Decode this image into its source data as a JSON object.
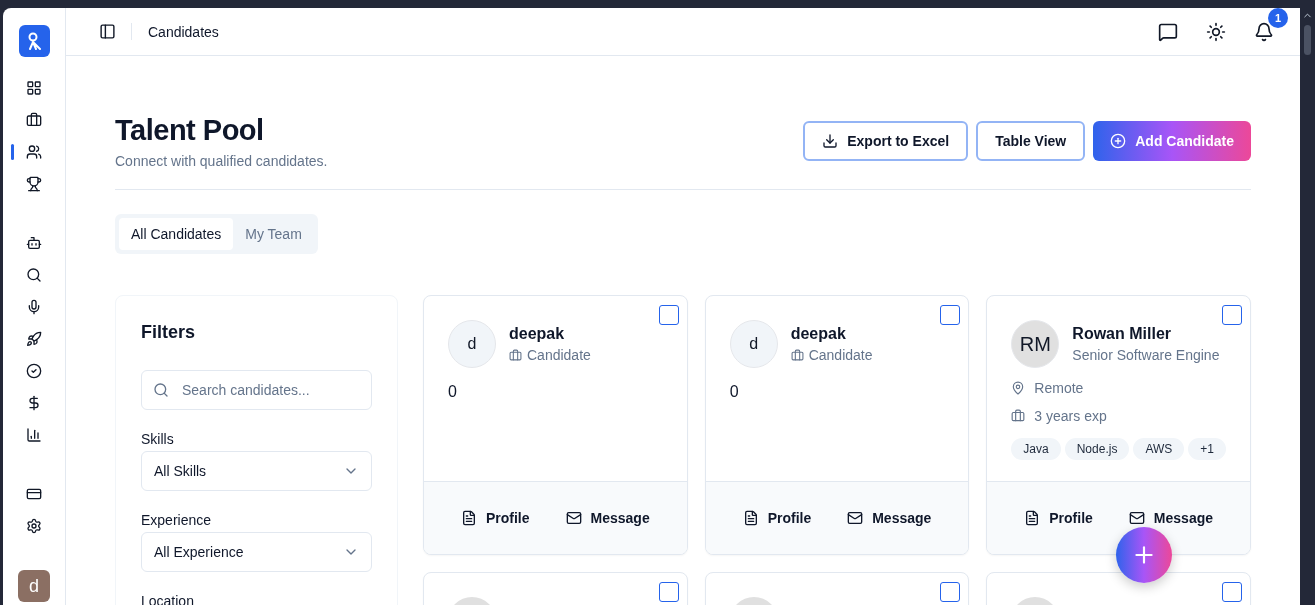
{
  "sidebar": {
    "avatar": "d",
    "groups": [
      [
        {
          "selected": false
        },
        {
          "selected": false
        },
        {
          "selected": true
        },
        {
          "selected": false
        }
      ],
      [
        {
          "selected": false
        },
        {
          "selected": false
        },
        {
          "selected": false
        },
        {
          "selected": false
        },
        {
          "selected": false
        },
        {
          "selected": false
        },
        {
          "selected": false
        }
      ],
      [
        {
          "selected": false
        },
        {
          "selected": false
        }
      ]
    ]
  },
  "header": {
    "title": "Candidates",
    "notifications": "1"
  },
  "page": {
    "title": "Talent Pool",
    "subtitle": "Connect with qualified candidates.",
    "buttons": [
      {
        "kind": "export",
        "label": "Export to Excel"
      },
      {
        "kind": "outline",
        "label": "Table View"
      },
      {
        "kind": "add",
        "label": "Add Candidate"
      }
    ]
  },
  "tabs": [
    {
      "label": "All Candidates",
      "selected": true
    },
    {
      "label": "My Team",
      "selected": false
    }
  ],
  "filters": {
    "title": "Filters",
    "search": {
      "placeholder": "Search candidates..."
    },
    "fields": [
      {
        "label": "Skills",
        "value": "All Skills"
      },
      {
        "label": "Experience",
        "value": "All Experience"
      }
    ],
    "next_label": "Location"
  },
  "cards": [
    {
      "kind": "basic",
      "checked": false,
      "initials": "d",
      "name": "deepak",
      "role": "Candidate",
      "note": "0",
      "actions": [
        "Profile",
        "Message"
      ]
    },
    {
      "kind": "basic",
      "checked": false,
      "initials": "d",
      "name": "deepak",
      "role": "Candidate",
      "note": "0",
      "actions": [
        "Profile",
        "Message"
      ]
    },
    {
      "kind": "detailed",
      "checked": false,
      "initials": "RM",
      "name": "Rowan Miller",
      "role": "Senior Software Engine",
      "location": "Remote",
      "experience": "3 years exp",
      "skills": [
        "Java",
        "Node.js",
        "AWS",
        "+1"
      ],
      "actions": [
        "Profile",
        "Message"
      ]
    },
    {
      "kind": "cut",
      "checked": false
    },
    {
      "kind": "cut",
      "checked": false
    },
    {
      "kind": "cut",
      "checked": false
    }
  ]
}
